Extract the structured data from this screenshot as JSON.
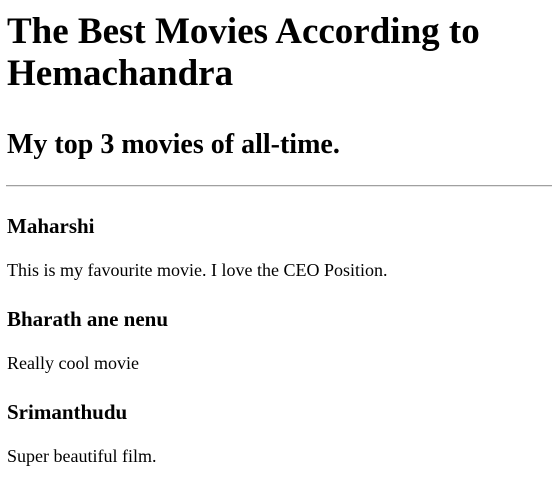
{
  "page": {
    "title": "The Best Movies According to Hemachandra",
    "subtitle": "My top 3 movies of all-time."
  },
  "movies": [
    {
      "name": "Maharshi",
      "description": "This is my favourite movie. I love the CEO Position."
    },
    {
      "name": "Bharath ane nenu",
      "description": "Really cool movie"
    },
    {
      "name": "Srimanthudu",
      "description": "Super beautiful film."
    }
  ]
}
